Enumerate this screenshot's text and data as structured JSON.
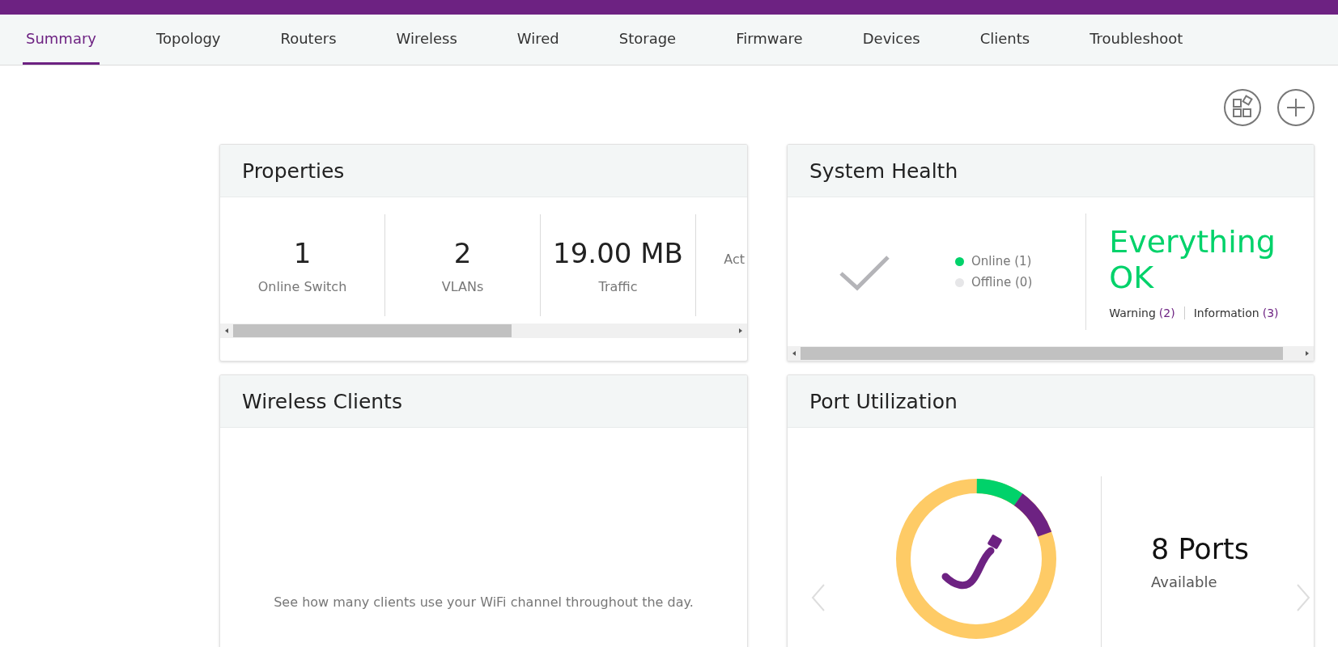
{
  "tabs": [
    {
      "label": "Summary",
      "selected": true
    },
    {
      "label": "Topology",
      "selected": false
    },
    {
      "label": "Routers",
      "selected": false
    },
    {
      "label": "Wireless",
      "selected": false
    },
    {
      "label": "Wired",
      "selected": false
    },
    {
      "label": "Storage",
      "selected": false
    },
    {
      "label": "Firmware",
      "selected": false
    },
    {
      "label": "Devices",
      "selected": false
    },
    {
      "label": "Clients",
      "selected": false
    },
    {
      "label": "Troubleshoot",
      "selected": false
    }
  ],
  "properties": {
    "title": "Properties",
    "items": [
      {
        "value": "1",
        "label": "Online Switch"
      },
      {
        "value": "2",
        "label": "VLANs"
      },
      {
        "value": "19.00 MB",
        "label": "Traffic"
      },
      {
        "label": "Act"
      }
    ]
  },
  "system_health": {
    "title": "System Health",
    "statuses": [
      {
        "label": "Online (1)",
        "color": "#00d26a"
      },
      {
        "label": "Offline (0)",
        "color": "#e6e6e8"
      }
    ],
    "message": "Everything OK",
    "alerts": [
      {
        "label": "Warning",
        "count": "(2)"
      },
      {
        "label": "Information",
        "count": "(3)"
      }
    ]
  },
  "wireless_clients": {
    "title": "Wireless Clients",
    "hint": "See how many clients use your WiFi channel throughout the day."
  },
  "port_utilization": {
    "title": "Port Utilization",
    "count": "8 Ports",
    "caption": "Available"
  }
}
